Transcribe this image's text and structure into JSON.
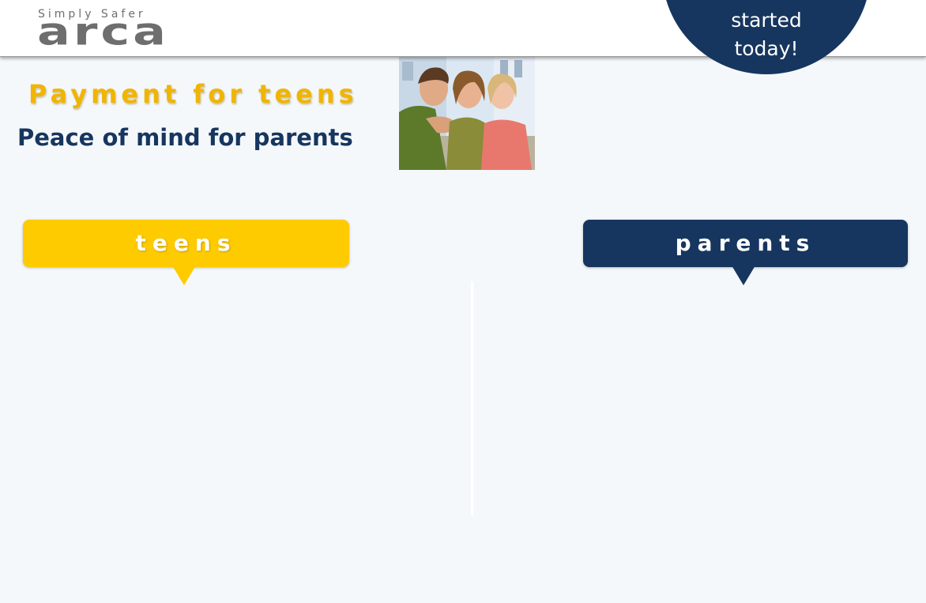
{
  "header": {
    "tagline": "Simply Safer",
    "brand": "arca",
    "cta_label": "Get started today!"
  },
  "hero": {
    "headline": "Payment for teens",
    "subhead": "Peace of mind for parents",
    "photo_alt": "photo"
  },
  "tabs": [
    {
      "label": "teens",
      "color": "#fecb00"
    },
    {
      "label": "parents",
      "color": "#16365f"
    }
  ],
  "colors": {
    "brand_navy": "#16365f",
    "brand_yellow": "#fecb00",
    "headline_yellow": "#f0b500",
    "logo_gray": "#6e6e6e",
    "background": "#f5f8fb"
  }
}
